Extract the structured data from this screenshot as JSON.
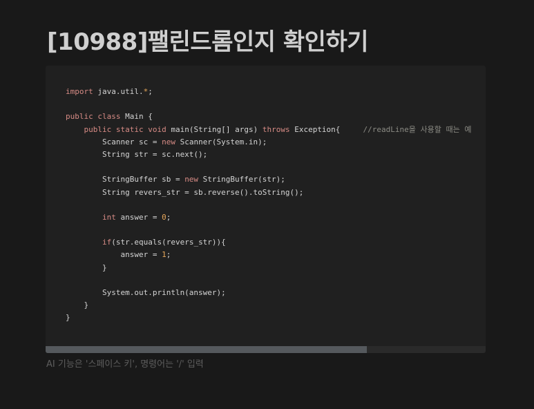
{
  "page": {
    "title": "[10988]팰린드롬인지 확인하기",
    "placeholder_hint": "AI 기능은 '스페이스 키', 명령어는 '/' 입력"
  },
  "code_block": {
    "language": "java",
    "scroll_fraction_visible": 0.73,
    "lines": [
      "import java.util.*;",
      "",
      "public class Main {",
      "    public static void main(String[] args) throws Exception{     //readLine을 사용할 때는 예",
      "        Scanner sc = new Scanner(System.in);",
      "        String str = sc.next();",
      "",
      "        StringBuffer sb = new StringBuffer(str);",
      "        String revers_str = sb.reverse().toString();",
      "",
      "        int answer = 0;",
      "",
      "        if(str.equals(revers_str)){",
      "            answer = 1;",
      "        }",
      "",
      "        System.out.println(answer);",
      "    }",
      "}"
    ]
  },
  "colors": {
    "background": "#191919",
    "code_background": "#202020",
    "keyword": "#d78b85",
    "number": "#e7a75a",
    "comment": "#8b8b84",
    "text": "#d4d4d4"
  }
}
